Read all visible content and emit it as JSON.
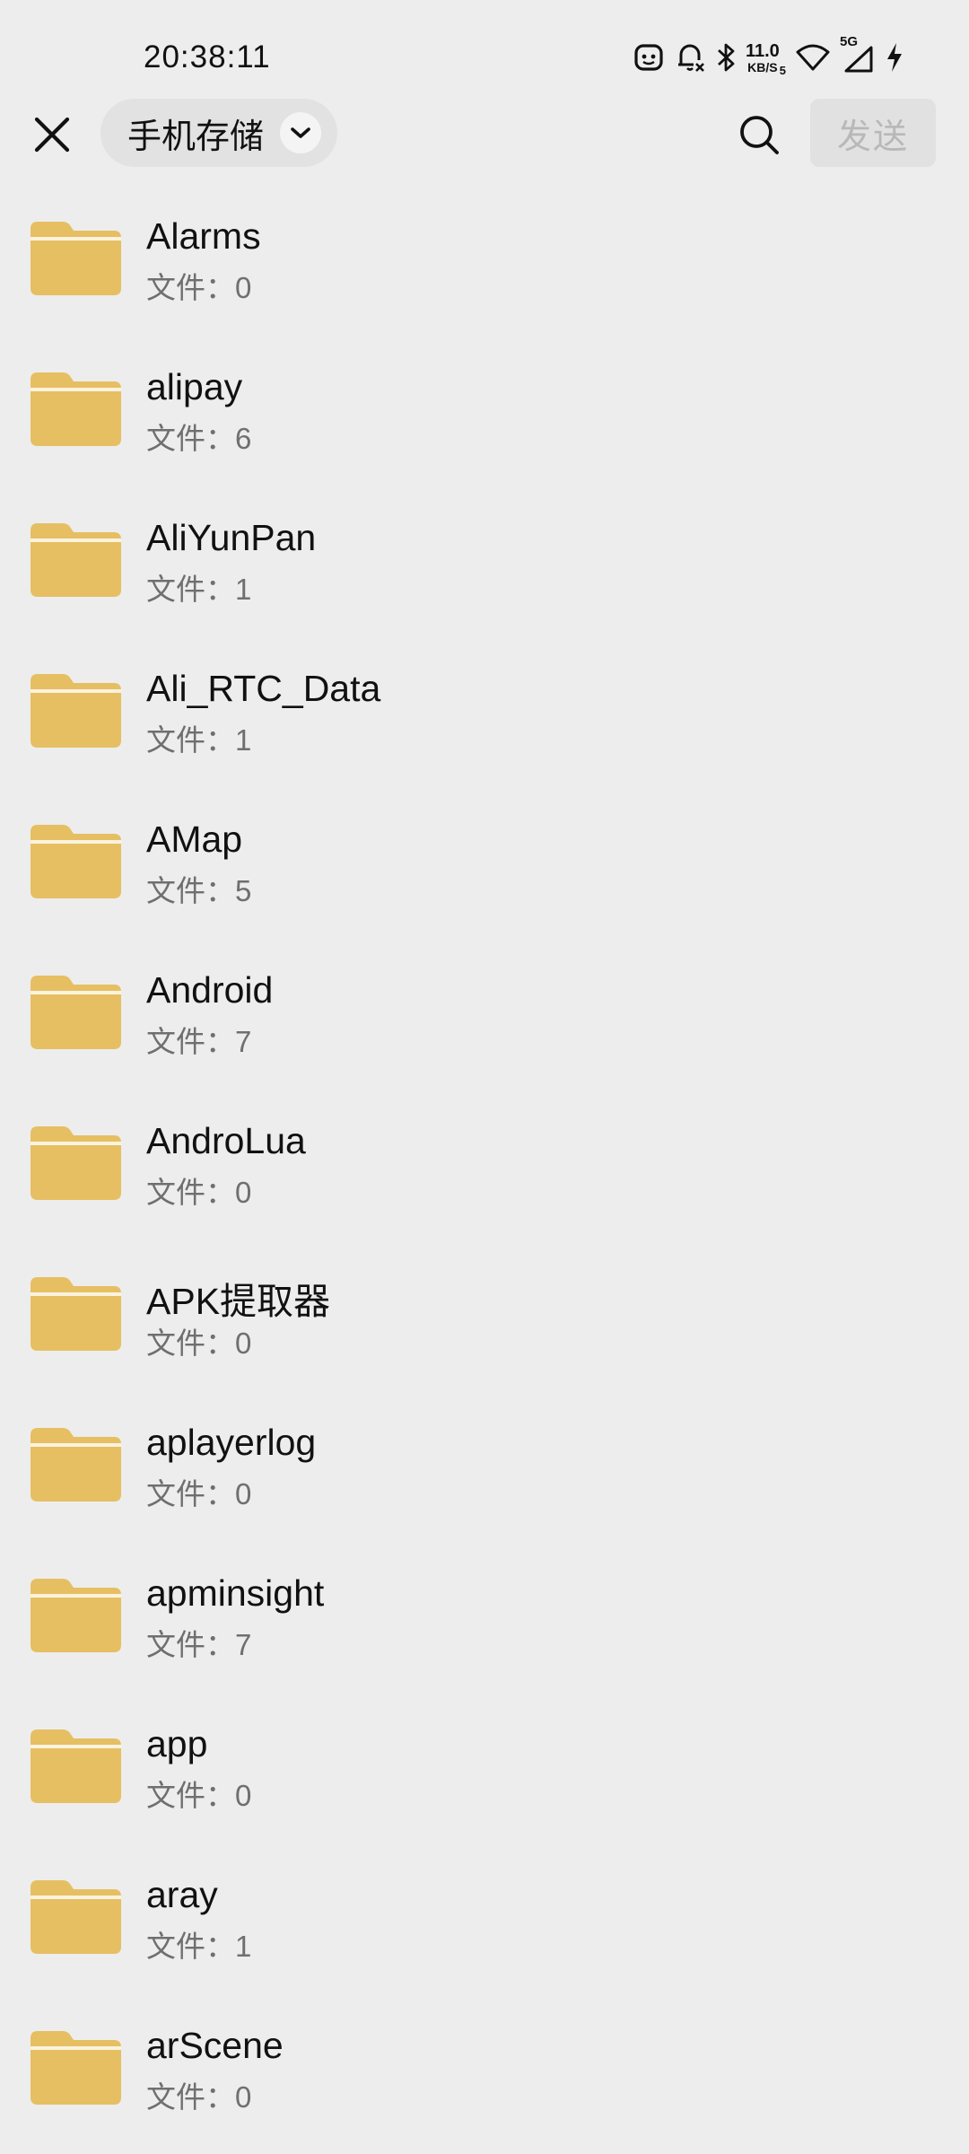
{
  "status_bar": {
    "time": "20:38:11",
    "net_speed_value": "11.0",
    "net_speed_unit": "KB/S",
    "wifi_sub": "5",
    "network_type": "5G"
  },
  "top_bar": {
    "storage_label": "手机存储",
    "send_label": "发送"
  },
  "files": [
    {
      "name": "Alarms",
      "meta_label": "文件：",
      "count": "0"
    },
    {
      "name": "alipay",
      "meta_label": "文件：",
      "count": "6"
    },
    {
      "name": "AliYunPan",
      "meta_label": "文件：",
      "count": "1"
    },
    {
      "name": "Ali_RTC_Data",
      "meta_label": "文件：",
      "count": "1"
    },
    {
      "name": "AMap",
      "meta_label": "文件：",
      "count": "5"
    },
    {
      "name": "Android",
      "meta_label": "文件：",
      "count": "7"
    },
    {
      "name": "AndroLua",
      "meta_label": "文件：",
      "count": "0"
    },
    {
      "name": "APK提取器",
      "meta_label": "文件：",
      "count": "0"
    },
    {
      "name": "aplayerlog",
      "meta_label": "文件：",
      "count": "0"
    },
    {
      "name": "apminsight",
      "meta_label": "文件：",
      "count": "7"
    },
    {
      "name": "app",
      "meta_label": "文件：",
      "count": "0"
    },
    {
      "name": "aray",
      "meta_label": "文件：",
      "count": "1"
    },
    {
      "name": "arScene",
      "meta_label": "文件：",
      "count": "0"
    }
  ],
  "icons": {
    "close": "close-icon",
    "dropdown": "chevron-down-icon",
    "search": "search-icon",
    "folder": "folder-icon"
  },
  "colors": {
    "background": "#ededed",
    "folder": "#e6bf63",
    "send_disabled_text": "#b8b8b8"
  }
}
